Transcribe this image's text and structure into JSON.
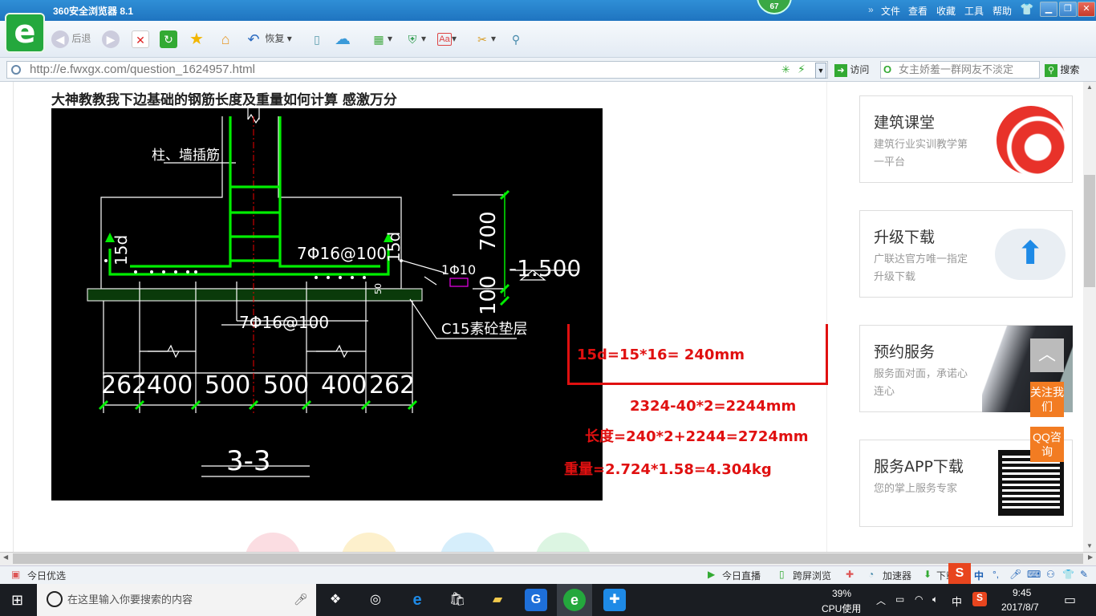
{
  "window": {
    "title": "360安全浏览器 8.1",
    "badge": "67",
    "menu": [
      "文件",
      "查看",
      "收藏",
      "工具",
      "帮助"
    ]
  },
  "toolbar": {
    "back_label": "后退",
    "restore_label": "恢复"
  },
  "addressbar": {
    "url": "http://e.fwxgx.com/question_1624957.html",
    "go_label": "访问",
    "search_placeholder": "女主娇羞一群网友不淡定",
    "search_label": "搜索"
  },
  "question": {
    "title": "大神教教我下边基础的钢筋长度及重量如何计算 感激万分"
  },
  "drawing": {
    "labels": {
      "column_bars": "柱、墙插筋",
      "top_rebar": "7Φ16@100",
      "bottom_rebar": "7Φ16@100",
      "hook_left": "15d",
      "hook_right": "15d",
      "height_700": "700",
      "height_100": "100",
      "elevation": "-1.500",
      "bar_1phi10": "1Φ10",
      "cover": "50",
      "pad": "C15素砼垫层",
      "section": "3-3"
    },
    "dimensions": [
      "262",
      "400",
      "500",
      "500",
      "400",
      "262"
    ]
  },
  "answer": {
    "line1": "15d=15*16= 240mm",
    "line2": "2324-40*2=2244mm",
    "line3": "长度=240*2+2244=2724mm",
    "line4": "重量=2.724*1.58=4.304kg"
  },
  "sidebar": {
    "cards": [
      {
        "title": "建筑课堂",
        "desc": "建筑行业实训教学第一平台",
        "icon": "brand-logo-icon"
      },
      {
        "title": "升级下载",
        "desc": "广联达官方唯一指定升级下载",
        "icon": "cloud-upload-icon"
      },
      {
        "title": "预约服务",
        "desc": "服务面对面，承诺心连心",
        "icon": "service-photo-icon"
      },
      {
        "title": "服务APP下载",
        "desc": "您的掌上服务专家",
        "icon": "qr-code-icon"
      }
    ],
    "follow_label": "关注我们",
    "qq_label": "QQ咨询",
    "totop_label": "︿"
  },
  "statusbar": {
    "left": "今日优选",
    "live": "今日直播",
    "cross": "跨屏浏览",
    "speed": "加速器",
    "download": "下载"
  },
  "taskbar": {
    "search_placeholder": "在这里输入你要搜索的内容",
    "cpu_percent": "39%",
    "cpu_label": "CPU使用",
    "time": "9:45",
    "date": "2017/8/7",
    "ime": "中"
  },
  "colors": {
    "accent": "#1f74c0",
    "answer_red": "#e01010",
    "cad_green": "#00e000",
    "side_orange": "#f27c22"
  }
}
